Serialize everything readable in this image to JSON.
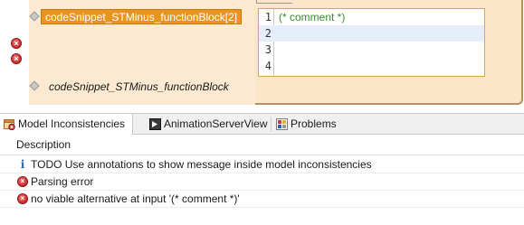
{
  "editor": {
    "selected_snippet": "codeSnippet_STMinus_functionBlock[2]",
    "snippet_label": "codeSnippet_STMinus_functionBlock",
    "code_lines": [
      {
        "number": "1",
        "text": "(* comment *)"
      },
      {
        "number": "2",
        "text": ""
      },
      {
        "number": "3",
        "text": ""
      },
      {
        "number": "4",
        "text": ""
      }
    ],
    "error_markers": [
      "error-icon",
      "error-icon"
    ]
  },
  "tabs": [
    {
      "label": "Model Inconsistencies",
      "icon": "model-inconsistencies-icon",
      "active": true
    },
    {
      "label": "AnimationServerView",
      "icon": "animation-server-icon",
      "active": false
    },
    {
      "label": "Problems",
      "icon": "problems-icon",
      "active": false
    }
  ],
  "table": {
    "header": "Description",
    "rows": [
      {
        "icon": "info-icon",
        "text": "TODO Use annotations to show message inside model inconsistencies"
      },
      {
        "icon": "error-icon",
        "text": "Parsing error"
      },
      {
        "icon": "error-icon",
        "text": "no viable alternative at input '(* comment *)'"
      }
    ]
  },
  "colors": {
    "block_fill": "#fbe6c9",
    "selection": "#e8951f",
    "comment_green": "#3a8a2e",
    "error_red": "#d43a3a",
    "info_blue": "#2a64b8"
  }
}
